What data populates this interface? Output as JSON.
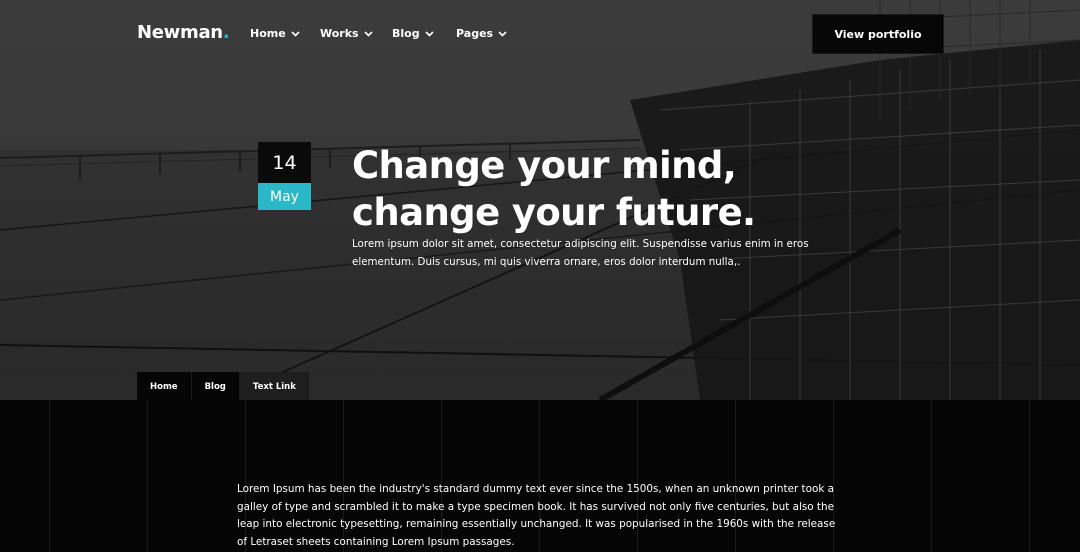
{
  "brand": {
    "name": "Newman",
    "dot": ".",
    "accent_color": "#2ab8c9"
  },
  "nav": {
    "items": [
      {
        "label": "Home",
        "icon": "chevron-down-icon"
      },
      {
        "label": "Works",
        "icon": "chevron-down-icon"
      },
      {
        "label": "Blog",
        "icon": "chevron-down-icon"
      },
      {
        "label": "Pages",
        "icon": "chevron-down-icon"
      }
    ],
    "cta_label": "View portfolio"
  },
  "post": {
    "date_day": "14",
    "date_month": "May",
    "title_line1": "Change your mind,",
    "title_line2": "change your future.",
    "excerpt": "Lorem ipsum dolor sit amet, consectetur adipiscing elit. Suspendisse varius enim in eros elementum. Duis cursus, mi quis viverra ornare, eros dolor interdum nulla,."
  },
  "breadcrumb": {
    "items": [
      "Home",
      "Blog",
      "Text Link"
    ]
  },
  "content": {
    "body": "Lorem Ipsum has been the industry's standard dummy text ever since the 1500s, when an unknown printer took a galley of type and scrambled it to make a type specimen book. It has survived not only five centuries, but also the leap into electronic typesetting, remaining essentially unchanged. It was popularised in the 1960s with the release of Letraset sheets containing Lorem Ipsum passages."
  }
}
